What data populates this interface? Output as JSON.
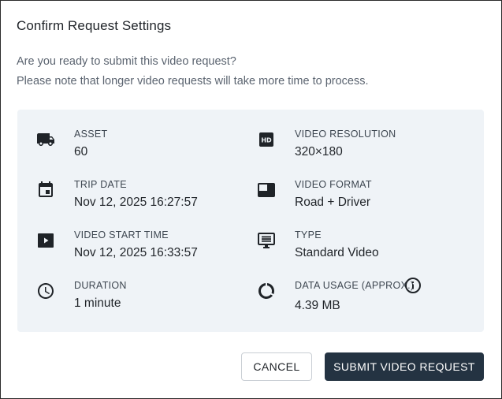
{
  "dialog": {
    "title": "Confirm Request Settings",
    "description_line1": "Are you ready to submit this video request?",
    "description_line2": "Please note that longer video requests will take more time to process."
  },
  "details": {
    "asset": {
      "label": "ASSET",
      "value": "60",
      "icon": "truck-icon"
    },
    "trip_date": {
      "label": "TRIP DATE",
      "value": "Nov 12, 2025 16:27:57",
      "icon": "calendar-icon"
    },
    "video_start_time": {
      "label": "VIDEO START TIME",
      "value": "Nov 12, 2025 16:33:57",
      "icon": "play-icon"
    },
    "duration": {
      "label": "DURATION",
      "value": "1 minute",
      "icon": "clock-icon"
    },
    "video_resolution": {
      "label": "VIDEO RESOLUTION",
      "value": "320×180",
      "icon": "hd-icon"
    },
    "video_format": {
      "label": "VIDEO FORMAT",
      "value": "Road + Driver",
      "icon": "picture-in-picture-icon"
    },
    "type": {
      "label": "TYPE",
      "value": "Standard Video",
      "icon": "monitor-list-icon"
    },
    "data_usage": {
      "label": "DATA USAGE (APPROX.)",
      "value": "4.39 MB",
      "icon": "donut-icon",
      "info_icon": "info-icon"
    }
  },
  "actions": {
    "cancel_label": "CANCEL",
    "submit_label": "SUBMIT VIDEO REQUEST"
  },
  "colors": {
    "panel_bg": "#eff3f7",
    "submit_bg": "#243342",
    "text_primary": "#1f2328",
    "text_secondary": "#5b6470"
  }
}
